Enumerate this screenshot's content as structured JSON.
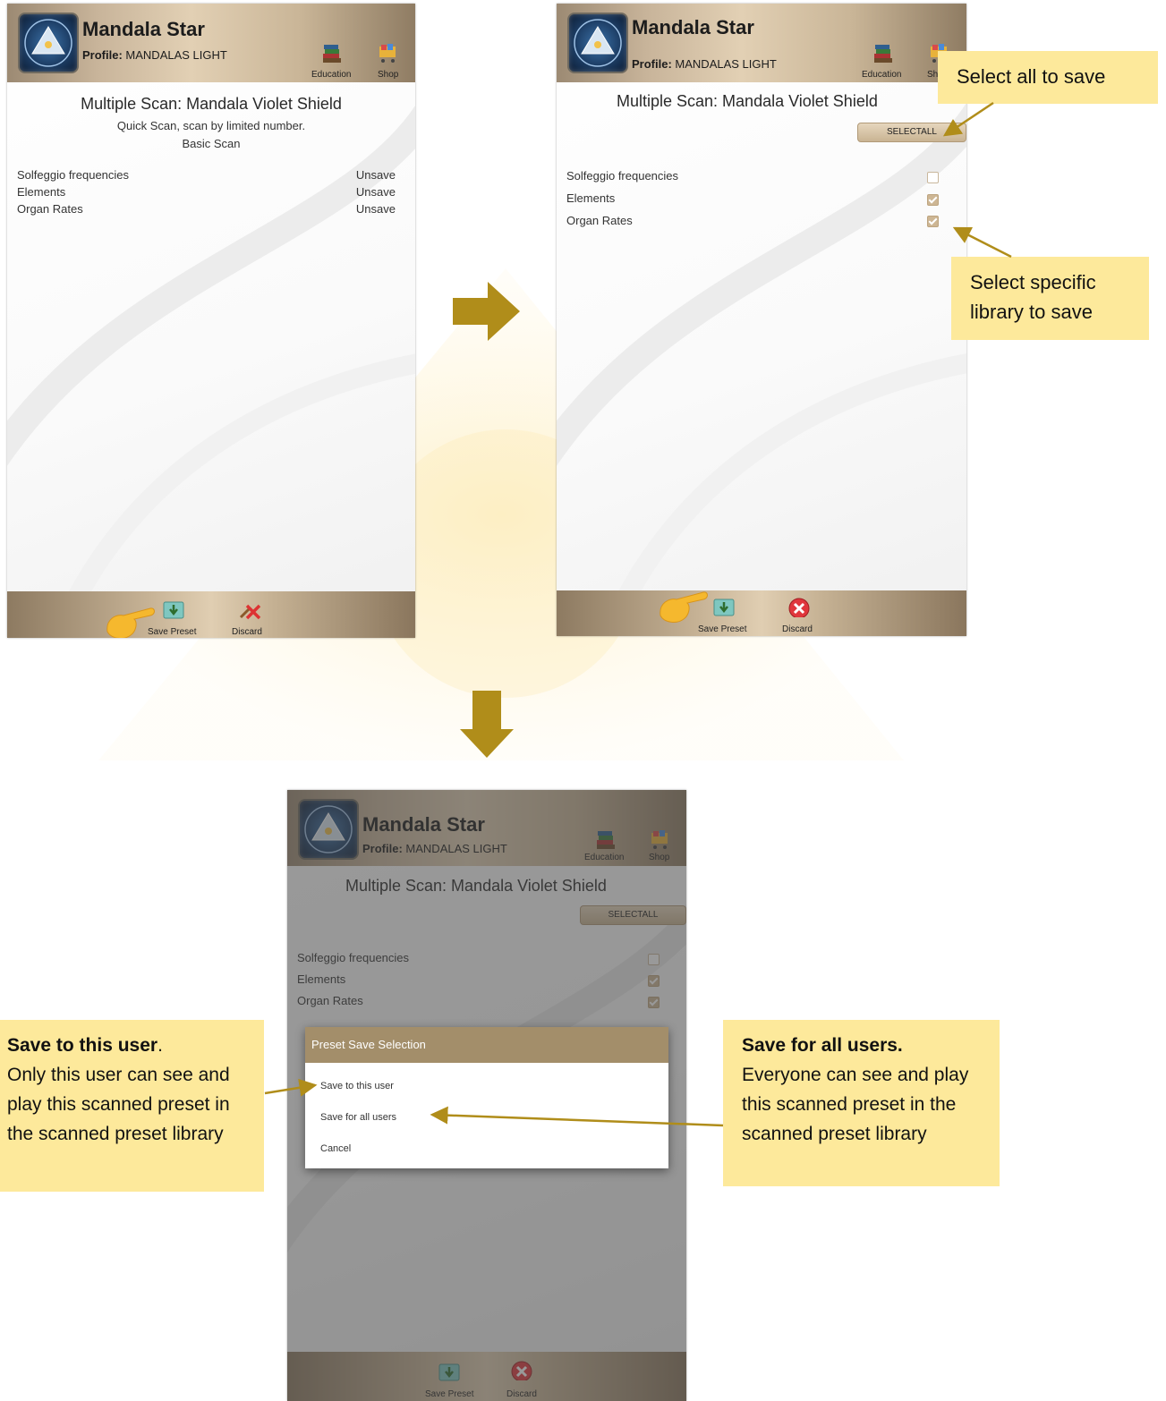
{
  "app": {
    "title": "Mandala Star",
    "profile_label": "Profile:",
    "profile_name": "MANDALAS LIGHT",
    "education_label": "Education",
    "shop_label": "Shop",
    "shop_label_cropped": "Sh"
  },
  "scan_title": "Multiple Scan: Mandala Violet Shield",
  "screen1": {
    "subtitle": "Quick Scan, scan by limited number.",
    "scan_type": "Basic Scan",
    "libraries": [
      {
        "label": "Solfeggio frequencies",
        "state": "Unsave"
      },
      {
        "label": "Elements",
        "state": "Unsave"
      },
      {
        "label": "Organ Rates",
        "state": "Unsave"
      }
    ]
  },
  "selectall_label": "SELECTALL",
  "libraries": [
    {
      "label": "Solfeggio frequencies",
      "checked": false
    },
    {
      "label": "Elements",
      "checked": true
    },
    {
      "label": "Organ Rates",
      "checked": true
    }
  ],
  "footer": {
    "save_preset": "Save Preset",
    "discard": "Discard"
  },
  "dialog": {
    "title": "Preset Save Selection",
    "options": [
      "Save to this user",
      "Save for all users",
      "Cancel"
    ]
  },
  "callouts": {
    "select_all": "Select all to save",
    "select_specific": "Select specific library to save",
    "this_user_title": "Save to this user",
    "this_user_title_suffix": ".",
    "this_user_body": "Only this user can see and play this scanned preset in the scanned preset library",
    "all_users_title": "Save for all users.",
    "all_users_body": "Everyone can see and play this scanned preset in the scanned preset library"
  },
  "colors": {
    "accent_gold": "#b08d1a",
    "callout_yellow": "#fde99b",
    "dialog_header": "#a38e6a"
  }
}
